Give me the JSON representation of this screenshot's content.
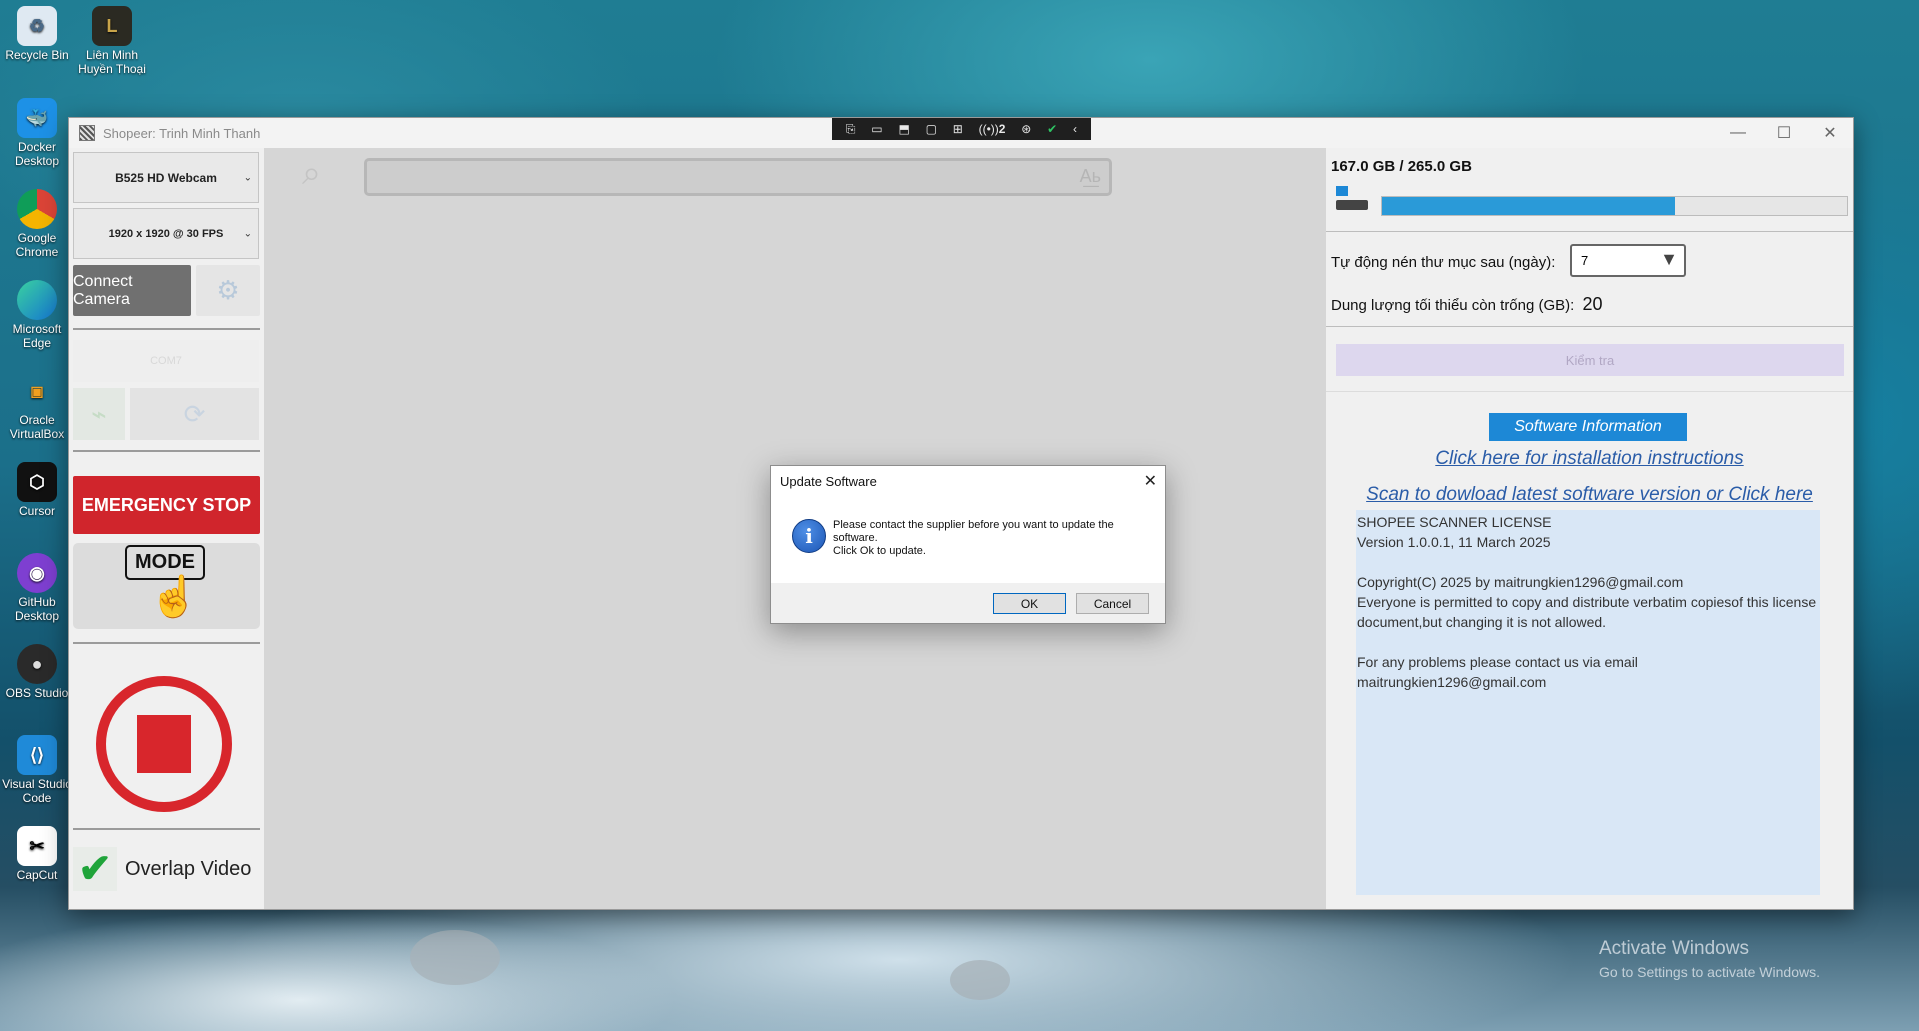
{
  "desktop": {
    "icons": [
      {
        "label": "Recycle Bin"
      },
      {
        "label": "Liên Minh Huyền Thoại"
      },
      {
        "label": "Docker Desktop"
      },
      {
        "label": "Google Chrome"
      },
      {
        "label": "Microsoft Edge"
      },
      {
        "label": "Oracle VirtualBox"
      },
      {
        "label": "Cursor"
      },
      {
        "label": "GitHub Desktop"
      },
      {
        "label": "OBS Studio"
      },
      {
        "label": "Visual Studio Code"
      },
      {
        "label": "CapCut"
      }
    ],
    "watermark_line1": "Activate Windows",
    "watermark_line2": "Go to Settings to activate Windows."
  },
  "window": {
    "title": "Shopeer: Trinh Minh Thanh",
    "rdp_session_count": "2"
  },
  "left": {
    "camera_select": "B525 HD Webcam",
    "resolution_select": "1920 x 1920 @ 30 FPS",
    "connect_label": "Connect Camera",
    "com_port": "COM7",
    "emergency_label": "EMERGENCY STOP",
    "mode_label": "MODE",
    "overlap_label": "Overlap Video"
  },
  "center": {
    "scan_value": ""
  },
  "right": {
    "storage_text": "167.0 GB / 265.0 GB",
    "storage_fraction": 0.63,
    "auto_compress_label": "Tự động nén thư mục sau (ngày):",
    "auto_compress_value": "7",
    "min_free_label": "Dung lượng tối thiểu còn trống (GB):",
    "min_free_value": "20",
    "check_label": "Kiểm tra",
    "software_info_label": "Software Information",
    "install_link": "Click here for installation instructions",
    "download_link": "Scan to dowload latest software version or Click here",
    "license_text": "SHOPEE SCANNER LICENSE\nVersion 1.0.0.1, 11 March 2025\n\nCopyright(C) 2025 by maitrungkien1296@gmail.com\nEveryone is permitted to copy and distribute verbatim copiesof this license document,but changing it is not allowed.\n\nFor any problems please contact us via email\nmaitrungkien1296@gmail.com"
  },
  "dialog": {
    "title": "Update Software",
    "message_line1": "Please contact the supplier before you want to update the software.",
    "message_line2": "Click Ok to update.",
    "ok_label": "OK",
    "cancel_label": "Cancel"
  },
  "colors": {
    "accent_blue": "#1d88d6",
    "emergency_red": "#d0252c",
    "record_red": "#d8262c",
    "check_green": "#1fa43a",
    "progress_blue": "#2a9ad8"
  }
}
